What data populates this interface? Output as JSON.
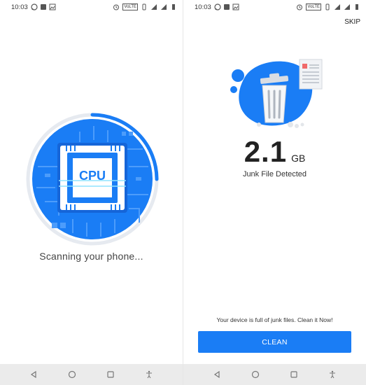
{
  "left_screen": {
    "status_bar": {
      "time": "10:03",
      "network_label": "VoLTE"
    },
    "cpu_chip_label": "CPU",
    "scan_label": "Scanning your phone..."
  },
  "right_screen": {
    "status_bar": {
      "time": "10:03",
      "network_label": "VoLTE"
    },
    "skip_label": "SKIP",
    "junk_size": "2.1",
    "junk_unit": "GB",
    "junk_label": "Junk File Detected",
    "warning_text": "Your device is full of junk files. Clean it Now!",
    "clean_label": "CLEAN"
  },
  "colors": {
    "accent": "#1a7df5",
    "nav_bar": "#ebebeb",
    "ring_light": "#e6eaf0"
  },
  "icons": {
    "status_left": [
      "whatsapp-icon",
      "square-icon",
      "gallery-icon"
    ],
    "status_right": [
      "alarm-icon",
      "volte-icon",
      "vibrate-icon",
      "signal-icon",
      "signal-icon",
      "battery-icon"
    ],
    "nav": [
      "back-icon",
      "home-icon",
      "recents-icon",
      "accessibility-icon"
    ]
  }
}
